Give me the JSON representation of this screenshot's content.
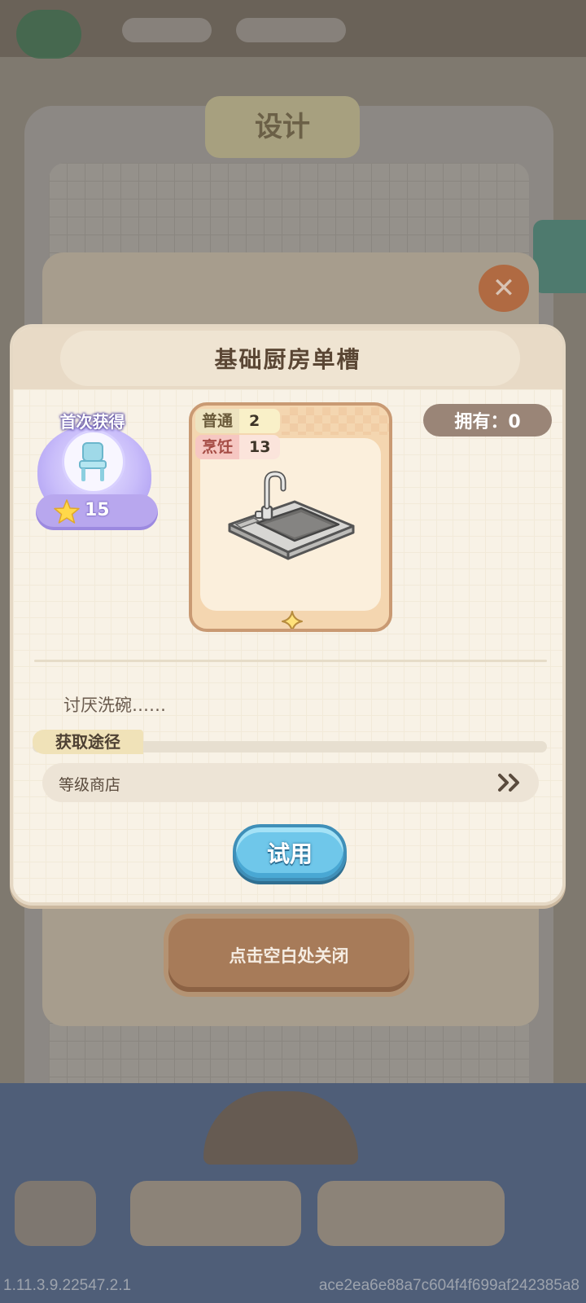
{
  "background": {
    "design_tab_label": "设计",
    "close_symbol": "✕"
  },
  "dialog": {
    "title": "基础厨房单槽",
    "first_get": {
      "label": "首次获得",
      "icon": "chair-icon",
      "reward_icon": "star-icon",
      "reward_count": "15"
    },
    "card": {
      "item_icon": "sink-icon",
      "stats": [
        {
          "label": "普通",
          "value": "2",
          "color": "#ede3c0"
        },
        {
          "label": "烹饪",
          "value": "13",
          "color": "#f6c7c2"
        }
      ]
    },
    "owned_text": "拥有：0",
    "description": "讨厌洗碗……",
    "source": {
      "header": "获取途径",
      "items": [
        {
          "label": "等级商店",
          "icon": "double-chevron-right-icon"
        }
      ]
    },
    "try_button": "试用"
  },
  "close_hint": "点击空白处关闭",
  "footer": {
    "version": "1.11.3.9.22547.2.1",
    "hash": "ace2ea6e88a7c604f4f699af242385a8"
  },
  "colors": {
    "accent_blue": "#6fc7ea",
    "card_border": "#c99a73",
    "owned_badge": "#9a8577"
  }
}
